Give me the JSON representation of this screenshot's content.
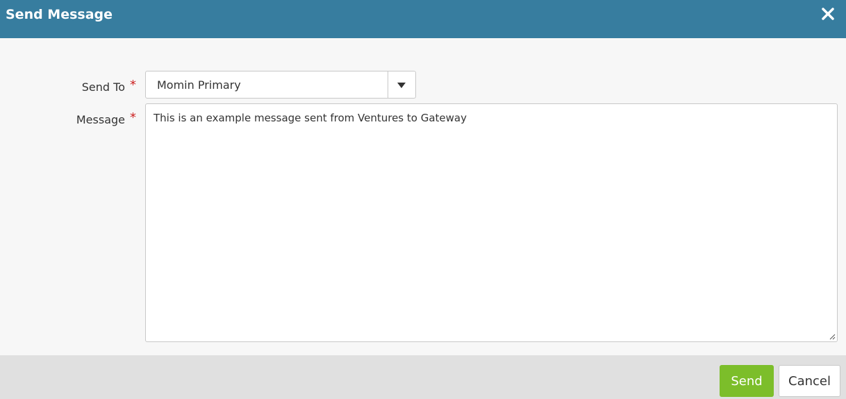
{
  "dialog": {
    "title": "Send Message",
    "close_icon": "close-icon"
  },
  "form": {
    "send_to": {
      "label": "Send To",
      "required_mark": "*",
      "selected": "Momin Primary",
      "dropdown_icon": "chevron-down-icon"
    },
    "message": {
      "label": "Message",
      "required_mark": "*",
      "value": "This is an example message sent from Ventures to Gateway"
    }
  },
  "footer": {
    "send_label": "Send",
    "cancel_label": "Cancel"
  },
  "colors": {
    "header_bg": "#377d9f",
    "send_button_bg": "#7cbe2a",
    "required_mark": "#cc2222",
    "footer_bg": "#e0e0e0"
  }
}
